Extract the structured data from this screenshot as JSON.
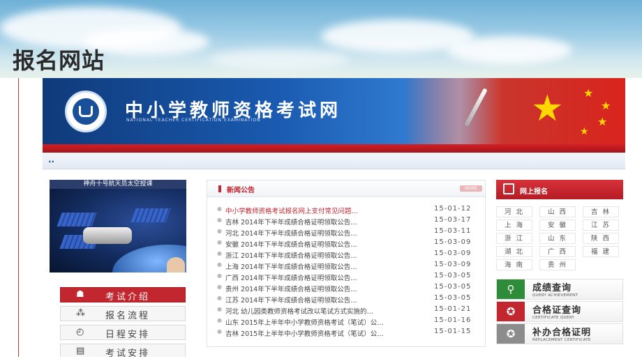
{
  "slide": {
    "title": "报名网站"
  },
  "site": {
    "name": "中小学教师资格考试网",
    "name_en": "NATIONAL TEACHER CERTIFICATION EXAMINATION",
    "nav_text": ".."
  },
  "promo": {
    "title": "神舟十号航天员太空授课"
  },
  "menu": {
    "items": [
      {
        "label": "考试介绍",
        "icon": "user-icon",
        "glyph": "☗",
        "active": true
      },
      {
        "label": "报名流程",
        "icon": "network-icon",
        "glyph": "⁂",
        "active": false
      },
      {
        "label": "日程安排",
        "icon": "clock-icon",
        "glyph": "◴",
        "active": false
      },
      {
        "label": "考试安排",
        "icon": "document-icon",
        "glyph": "▤",
        "active": false
      }
    ]
  },
  "news": {
    "title": "新闻公告",
    "more_label": "MORE",
    "items": [
      {
        "text": "中小学教师资格考试报名网上支付常见问题…",
        "date": "15-01-12",
        "hot": true
      },
      {
        "text": "吉林 2014年下半年成绩合格证明领取公告…",
        "date": "15-03-17",
        "hot": false
      },
      {
        "text": "河北 2014年下半年成绩合格证明领取公告…",
        "date": "15-03-11",
        "hot": false
      },
      {
        "text": "安徽 2014年下半年成绩合格证明领取公告…",
        "date": "15-03-09",
        "hot": false
      },
      {
        "text": "浙江 2014年下半年成绩合格证明领取公告…",
        "date": "15-03-09",
        "hot": false
      },
      {
        "text": "上海 2014年下半年成绩合格证明领取公告…",
        "date": "15-03-09",
        "hot": false
      },
      {
        "text": "广西 2014年下半年成绩合格证明领取公告…",
        "date": "15-03-05",
        "hot": false
      },
      {
        "text": "贵州 2014年下半年成绩合格证明领取公告…",
        "date": "15-03-05",
        "hot": false
      },
      {
        "text": "江苏 2014年下半年成绩合格证明领取公告…",
        "date": "15-03-05",
        "hot": false
      },
      {
        "text": "河北 幼儿园类教师资格考试改以笔试方式实施的…",
        "date": "15-01-21",
        "hot": false
      },
      {
        "text": "山东 2015年上半年中小学教师资格考试（笔试）公…",
        "date": "15-01-16",
        "hot": false
      },
      {
        "text": "吉林 2015年上半年中小学教师资格考试（笔试）公…",
        "date": "15-01-15",
        "hot": false
      }
    ]
  },
  "registration": {
    "title": "网上报名",
    "provinces": [
      "河 北",
      "山 西",
      "吉 林",
      "上 海",
      "安 徽",
      "江 苏",
      "浙 江",
      "山 东",
      "陕 西",
      "湖 北",
      "广 西",
      "福 建",
      "海 南",
      "贵 州"
    ]
  },
  "services": [
    {
      "cn": "成绩查询",
      "en": "QUERY ACHIEVEMENT",
      "icon": "search-icon",
      "glyph": "⚲",
      "color": "#2e8b3a"
    },
    {
      "cn": "合格证查询",
      "en": "CERTIFICATE QUERY",
      "icon": "award-icon",
      "glyph": "✪",
      "color": "#c2262e"
    },
    {
      "cn": "补办合格证明",
      "en": "REPLACEMENT CERTIFICATE",
      "icon": "award-gray-icon",
      "glyph": "✪",
      "color": "#8c8c8c"
    }
  ]
}
